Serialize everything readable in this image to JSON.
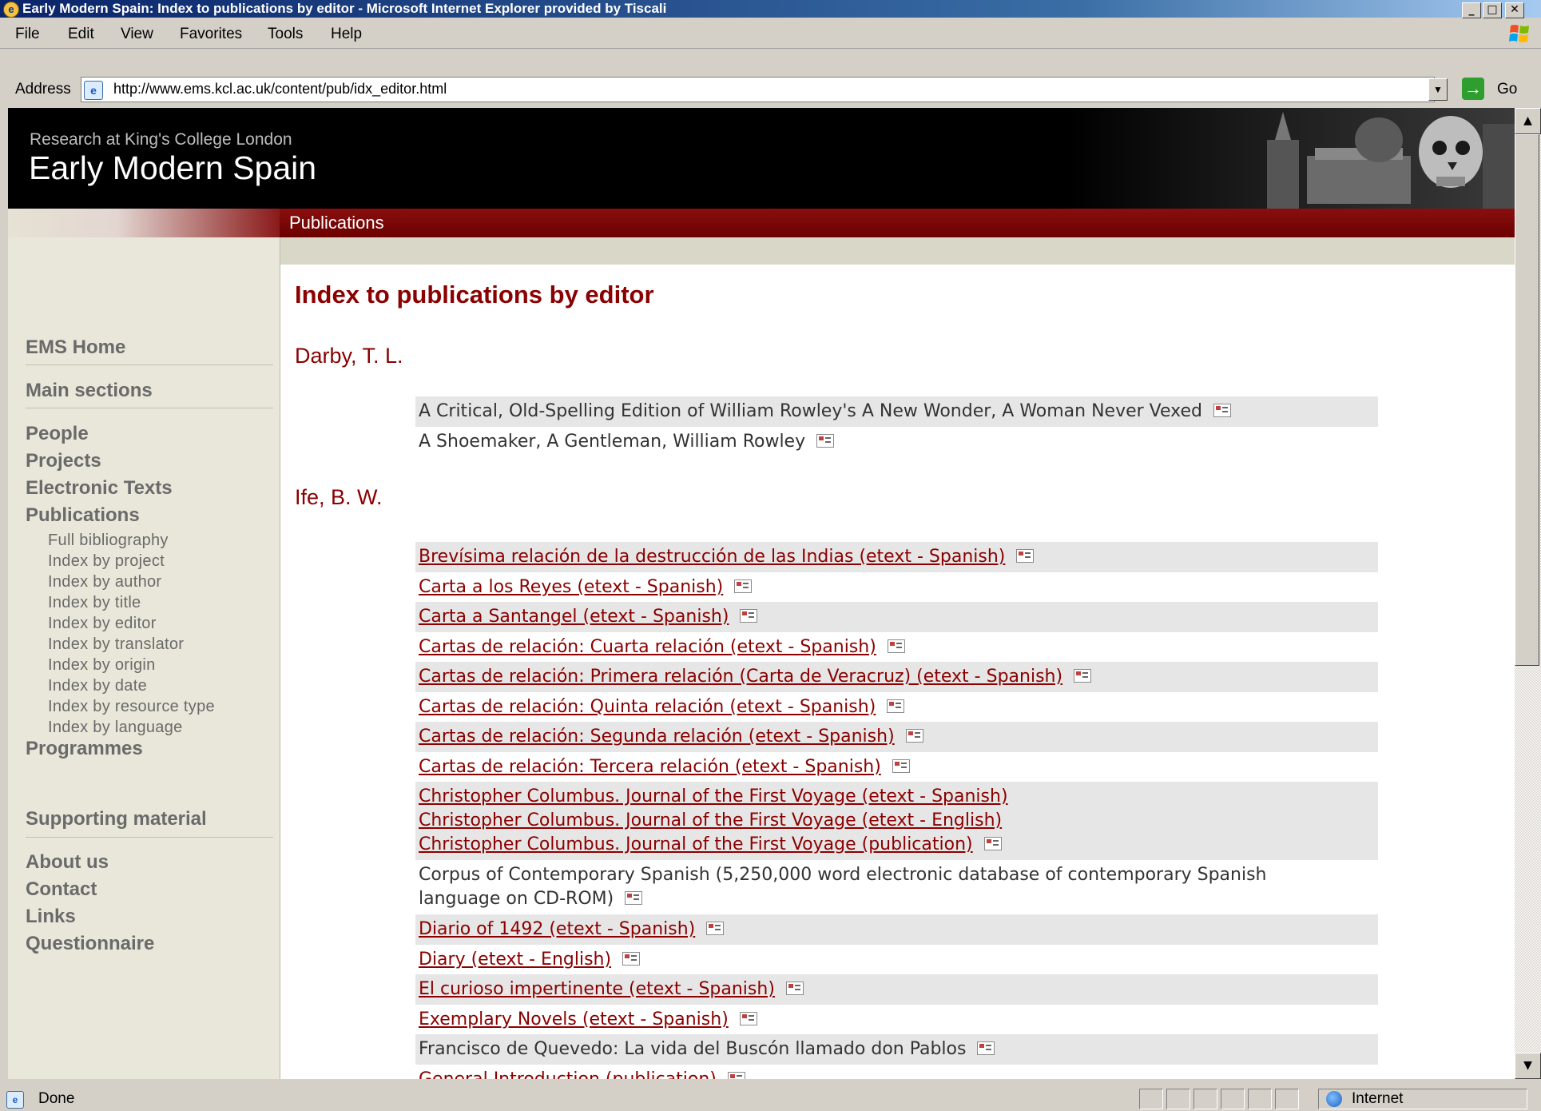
{
  "window": {
    "title": "Early Modern Spain: Index to publications by editor - Microsoft Internet Explorer provided by Tiscali",
    "controls": [
      "_",
      "×",
      "✕"
    ]
  },
  "menu": [
    "File",
    "Edit",
    "View",
    "Favorites",
    "Tools",
    "Help"
  ],
  "address": {
    "label": "Address",
    "url": "http://www.ems.kcl.ac.uk/content/pub/idx_editor.html",
    "go_label": "Go"
  },
  "banner": {
    "subtitle": "Research at King's College London",
    "title": "Early Modern Spain"
  },
  "section_title": "Publications",
  "sidebar": {
    "home": "EMS Home",
    "main_sections": "Main sections",
    "sections": [
      "People",
      "Projects",
      "Electronic Texts",
      "Publications"
    ],
    "sub_items": [
      "Full bibliography",
      "Index by project",
      "Index by author",
      "Index by title",
      "Index by editor",
      "Index by translator",
      "Index by origin",
      "Index by date",
      "Index by resource type",
      "Index by language"
    ],
    "programmes": "Programmes",
    "supporting": "Supporting material",
    "extra": [
      "About us",
      "Contact",
      "Links",
      "Questionnaire"
    ]
  },
  "content": {
    "page_title": "Index to publications by editor",
    "editors": [
      {
        "name": "Darby, T. L.",
        "items": [
          "A Critical, Old-Spelling Edition of William Rowley's A New Wonder, A Woman Never Vexed",
          "A Shoemaker, A Gentleman, William Rowley"
        ]
      },
      {
        "name": "Ife, B. W.",
        "items": [
          "Brevísima relación de la destrucción de las Indias (etext - Spanish)",
          "Carta a los Reyes (etext - Spanish)",
          "Carta a Santangel (etext - Spanish)",
          "Cartas de relación: Cuarta relación (etext - Spanish)",
          "Cartas de relación: Primera relación (Carta de Veracruz) (etext - Spanish)",
          "Cartas de relación: Quinta relación (etext - Spanish)",
          "Cartas de relación: Segunda relación (etext - Spanish)",
          "Cartas de relación: Tercera relación (etext - Spanish)",
          "Christopher Columbus. Journal of the First Voyage (etext - Spanish)",
          "Christopher Columbus. Journal of the First Voyage (etext - English)",
          "Christopher Columbus. Journal of the First Voyage (publication)",
          "Corpus of Contemporary Spanish (5,250,000 word electronic database of contemporary Spanish",
          "language on CD-ROM)",
          "Diario of 1492 (etext - Spanish)",
          "Diary (etext - English)",
          "El curioso impertinente (etext - Spanish)",
          "Exemplary Novels (etext - Spanish)",
          "Francisco de Quevedo: La vida del Buscón llamado don Pablos",
          "General Introduction  (publication)"
        ]
      }
    ]
  },
  "status": {
    "text": "Done",
    "zone": "Internet"
  }
}
